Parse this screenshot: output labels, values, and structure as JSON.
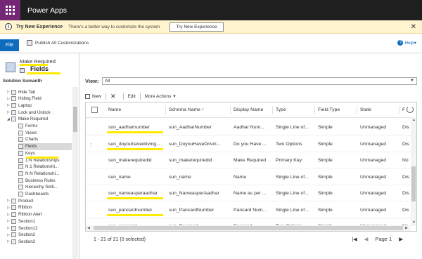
{
  "app": {
    "title": "Power Apps"
  },
  "banner": {
    "title": "Try New Experience",
    "text": "There's a better way to customize the system",
    "button": "Try New Experience",
    "close_icon": "close-icon"
  },
  "ribbon": {
    "file": "File",
    "publish": "Publish All Customizations",
    "help": "Help"
  },
  "entity": {
    "display_name": "Make Required",
    "page_title": "Fields"
  },
  "solution": {
    "label": "Solution Sumanth"
  },
  "tree": {
    "items": [
      {
        "label": "Hide Tab",
        "level": 0,
        "expanded": false
      },
      {
        "label": "Hiding Field",
        "level": 0,
        "expanded": false
      },
      {
        "label": "Laptop",
        "level": 0,
        "expanded": false
      },
      {
        "label": "Lock and Unlock",
        "level": 0,
        "expanded": false
      },
      {
        "label": "Make Required",
        "level": 0,
        "expanded": true
      },
      {
        "label": "Forms",
        "level": 1
      },
      {
        "label": "Views",
        "level": 1
      },
      {
        "label": "Charts",
        "level": 1
      },
      {
        "label": "Fields",
        "level": 1,
        "selected": true
      },
      {
        "label": "Keys",
        "level": 1
      },
      {
        "label": "1:N Relationships",
        "level": 1
      },
      {
        "label": "N:1 Relationshi...",
        "level": 1
      },
      {
        "label": "N:N Relationshi...",
        "level": 1
      },
      {
        "label": "Business Rules",
        "level": 1
      },
      {
        "label": "Hierarchy Setti...",
        "level": 1
      },
      {
        "label": "Dashboards",
        "level": 1
      },
      {
        "label": "Product",
        "level": 0,
        "expanded": false
      },
      {
        "label": "Ribbon",
        "level": 0,
        "expanded": false
      },
      {
        "label": "Ribbon Alert",
        "level": 0,
        "expanded": false
      },
      {
        "label": "Section1",
        "level": 0,
        "expanded": false
      },
      {
        "label": "Section12",
        "level": 0,
        "expanded": false
      },
      {
        "label": "Section2",
        "level": 0,
        "expanded": false
      },
      {
        "label": "Section3",
        "level": 0,
        "expanded": false
      }
    ]
  },
  "view": {
    "label": "View:",
    "selected": "All"
  },
  "commands": {
    "new": "New",
    "edit": "Edit",
    "more": "More Actions"
  },
  "grid": {
    "headers": [
      "Name",
      "Schema Name ↑",
      "Display Name",
      "Type",
      "Field Type",
      "State",
      "F"
    ],
    "rows": [
      {
        "name": "sun_aadharnumber",
        "schema": "sun_AadharNumber",
        "display": "Aadhar Num...",
        "type": "Single Line of...",
        "field_type": "Simple",
        "state": "Unmanaged",
        "extra": "Dis",
        "highlight": true
      },
      {
        "name": "sun_doyouhavedriving...",
        "schema": "sun_DoyouHaveDrivin...",
        "display": "Do you Have ...",
        "type": "Two Options",
        "field_type": "Simple",
        "state": "Unmanaged",
        "extra": "Dis",
        "highlight": true
      },
      {
        "name": "sun_makerequiredid",
        "schema": "sun_makerequiredid",
        "display": "Make Required",
        "type": "Primary Key",
        "field_type": "Simple",
        "state": "Unmanaged",
        "extra": "No",
        "highlight": false
      },
      {
        "name": "sun_name",
        "schema": "sun_name",
        "display": "Name",
        "type": "Single Line of...",
        "field_type": "Simple",
        "state": "Unmanaged",
        "extra": "Dis",
        "highlight": false
      },
      {
        "name": "sun_nameasperaadhar",
        "schema": "sun_NameasperAadhar",
        "display": "Name as per ...",
        "type": "Single Line of...",
        "field_type": "Simple",
        "state": "Unmanaged",
        "extra": "Dis",
        "highlight": true
      },
      {
        "name": "sun_pancardnumber",
        "schema": "sun_PancardNumber",
        "display": "Pancard Num...",
        "type": "Single Line of...",
        "field_type": "Simple",
        "state": "Unmanaged",
        "extra": "Dis",
        "highlight": true
      },
      {
        "name": "sun_passport",
        "schema": "sun_Passport",
        "display": "Passport",
        "type": "Two Options",
        "field_type": "Simple",
        "state": "Unmanaged",
        "extra": "No",
        "highlight": true
      }
    ]
  },
  "footer": {
    "record_count": "1 - 21 of 21 (0 selected)",
    "page": "Page 1"
  },
  "colors": {
    "brand": "#742774",
    "topbar": "#1f1f1f",
    "banner": "#fff4ce",
    "highlight": "#ffeb00",
    "file": "#0f6cbd"
  }
}
